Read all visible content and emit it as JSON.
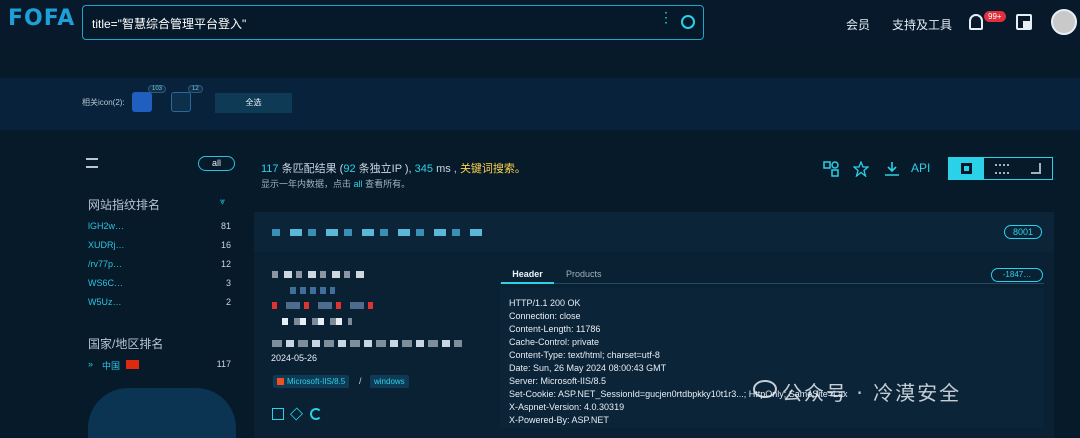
{
  "header": {
    "logo": "FOFA",
    "search_query": "title=\"智慧综合管理平台登入\"",
    "nav": {
      "membership": "会员",
      "support": "支持及工具"
    },
    "notification_badge": "99+"
  },
  "icon_filter": {
    "label": "相关icon(2):",
    "icons": [
      {
        "count": "103"
      },
      {
        "count": "12"
      }
    ],
    "select_all": "全选"
  },
  "sidebar": {
    "all_label": "all",
    "fingerprint_title": "网站指纹排名",
    "fingerprints": [
      {
        "name": "lGH2w…",
        "count": "81"
      },
      {
        "name": "XUDRj…",
        "count": "16"
      },
      {
        "name": "/rv77p…",
        "count": "12"
      },
      {
        "name": "WS6C…",
        "count": "3"
      },
      {
        "name": "W5Uz…",
        "count": "2"
      }
    ],
    "country_title": "国家/地区排名",
    "countries": [
      {
        "name": "中国",
        "count": "117"
      }
    ]
  },
  "results": {
    "total": "117",
    "total_text": " 条匹配结果 (",
    "unique_ip": "92",
    "unique_ip_text": " 条独立IP ), ",
    "time": "345",
    "time_unit": " ms ,",
    "keyword_search": "关键词搜索。",
    "note_prefix": "显示一年内数据，点击",
    "note_all": "all",
    "note_suffix": "查看所有。",
    "api": "API"
  },
  "result_card": {
    "port": "8001",
    "date": "2024-05-26",
    "server_tag": "Microsoft-IIS/8.5",
    "separator": "/",
    "os_tag": "windows",
    "tabs": {
      "header": "Header",
      "products": "Products"
    },
    "hash": "-1847…",
    "header_lines": [
      "HTTP/1.1 200 OK",
      "Connection: close",
      "Content-Length: 11786",
      "Cache-Control: private",
      "Content-Type: text/html; charset=utf-8",
      "Date: Sun, 26 May 2024 08:00:43 GMT",
      "Server: Microsoft-IIS/8.5",
      "Set-Cookie: ASP.NET_SessionId=gucjen0rtdbpkky10t1r3...; HttpOnly; SameSite=Lax",
      "X-Aspnet-Version: 4.0.30319",
      "X-Powered-By: ASP.NET"
    ]
  },
  "watermark": "公众号 · 冷漠安全"
}
